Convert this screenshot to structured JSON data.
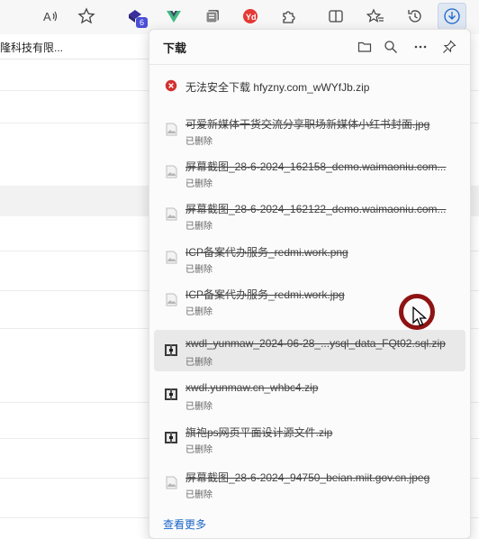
{
  "toolbar": {
    "read_aloud_icon": "read-aloud-icon",
    "favorite_icon": "favorite-star-icon",
    "extension_badge": "6",
    "icons": [
      "extension-cube-icon",
      "vue-icon",
      "collections-icon",
      "yd-extension-icon",
      "extensions-puzzle-icon",
      "split-screen-icon",
      "favorites-icon",
      "history-icon",
      "downloads-icon"
    ]
  },
  "background": {
    "tab_text": "隆科技有限..."
  },
  "downloads": {
    "title": "下载",
    "header_icons": [
      "open-folder-icon",
      "search-icon",
      "more-options-icon",
      "pin-icon"
    ],
    "items": [
      {
        "name": "无法安全下载 hfyzny.com_wWYfJb.zip",
        "status": "",
        "icon": "error-icon",
        "deleted": false
      },
      {
        "name": "可爱新媒体干货交流分享职场新媒体小红书封面.jpg",
        "status": "已删除",
        "icon": "image-file-icon",
        "deleted": true
      },
      {
        "name": "屏幕截图_28-6-2024_162158_demo.waimaoniu.com...",
        "status": "已删除",
        "icon": "image-file-icon",
        "deleted": true
      },
      {
        "name": "屏幕截图_28-6-2024_162122_demo.waimaoniu.com...",
        "status": "已删除",
        "icon": "image-file-icon",
        "deleted": true
      },
      {
        "name": "ICP备案代办服务_redmi.work.png",
        "status": "已删除",
        "icon": "image-file-icon",
        "deleted": true
      },
      {
        "name": "ICP备案代办服务_redmi.work.jpg",
        "status": "已删除",
        "icon": "image-file-icon",
        "deleted": true
      },
      {
        "name": "xwdl_yunmaw_2024-06-28_...ysql_data_FQt02.sql.zip",
        "status": "已删除",
        "icon": "archive-file-icon",
        "deleted": true
      },
      {
        "name": "xwdl.yunmaw.cn_whbc4.zip",
        "status": "已删除",
        "icon": "archive-file-icon",
        "deleted": true
      },
      {
        "name": "旗袍ps网页平面设计源文件.zip",
        "status": "已删除",
        "icon": "archive-file-icon",
        "deleted": true
      },
      {
        "name": "屏幕截图_28-6-2024_94750_beian.miit.gov.cn.jpeg",
        "status": "已删除",
        "icon": "image-file-icon",
        "deleted": true
      }
    ],
    "see_more": "查看更多"
  },
  "colors": {
    "accent": "#1a66c9",
    "error": "#d32f2f",
    "cursor_ring": "#8f1313",
    "badge": "#4b4fd6"
  }
}
